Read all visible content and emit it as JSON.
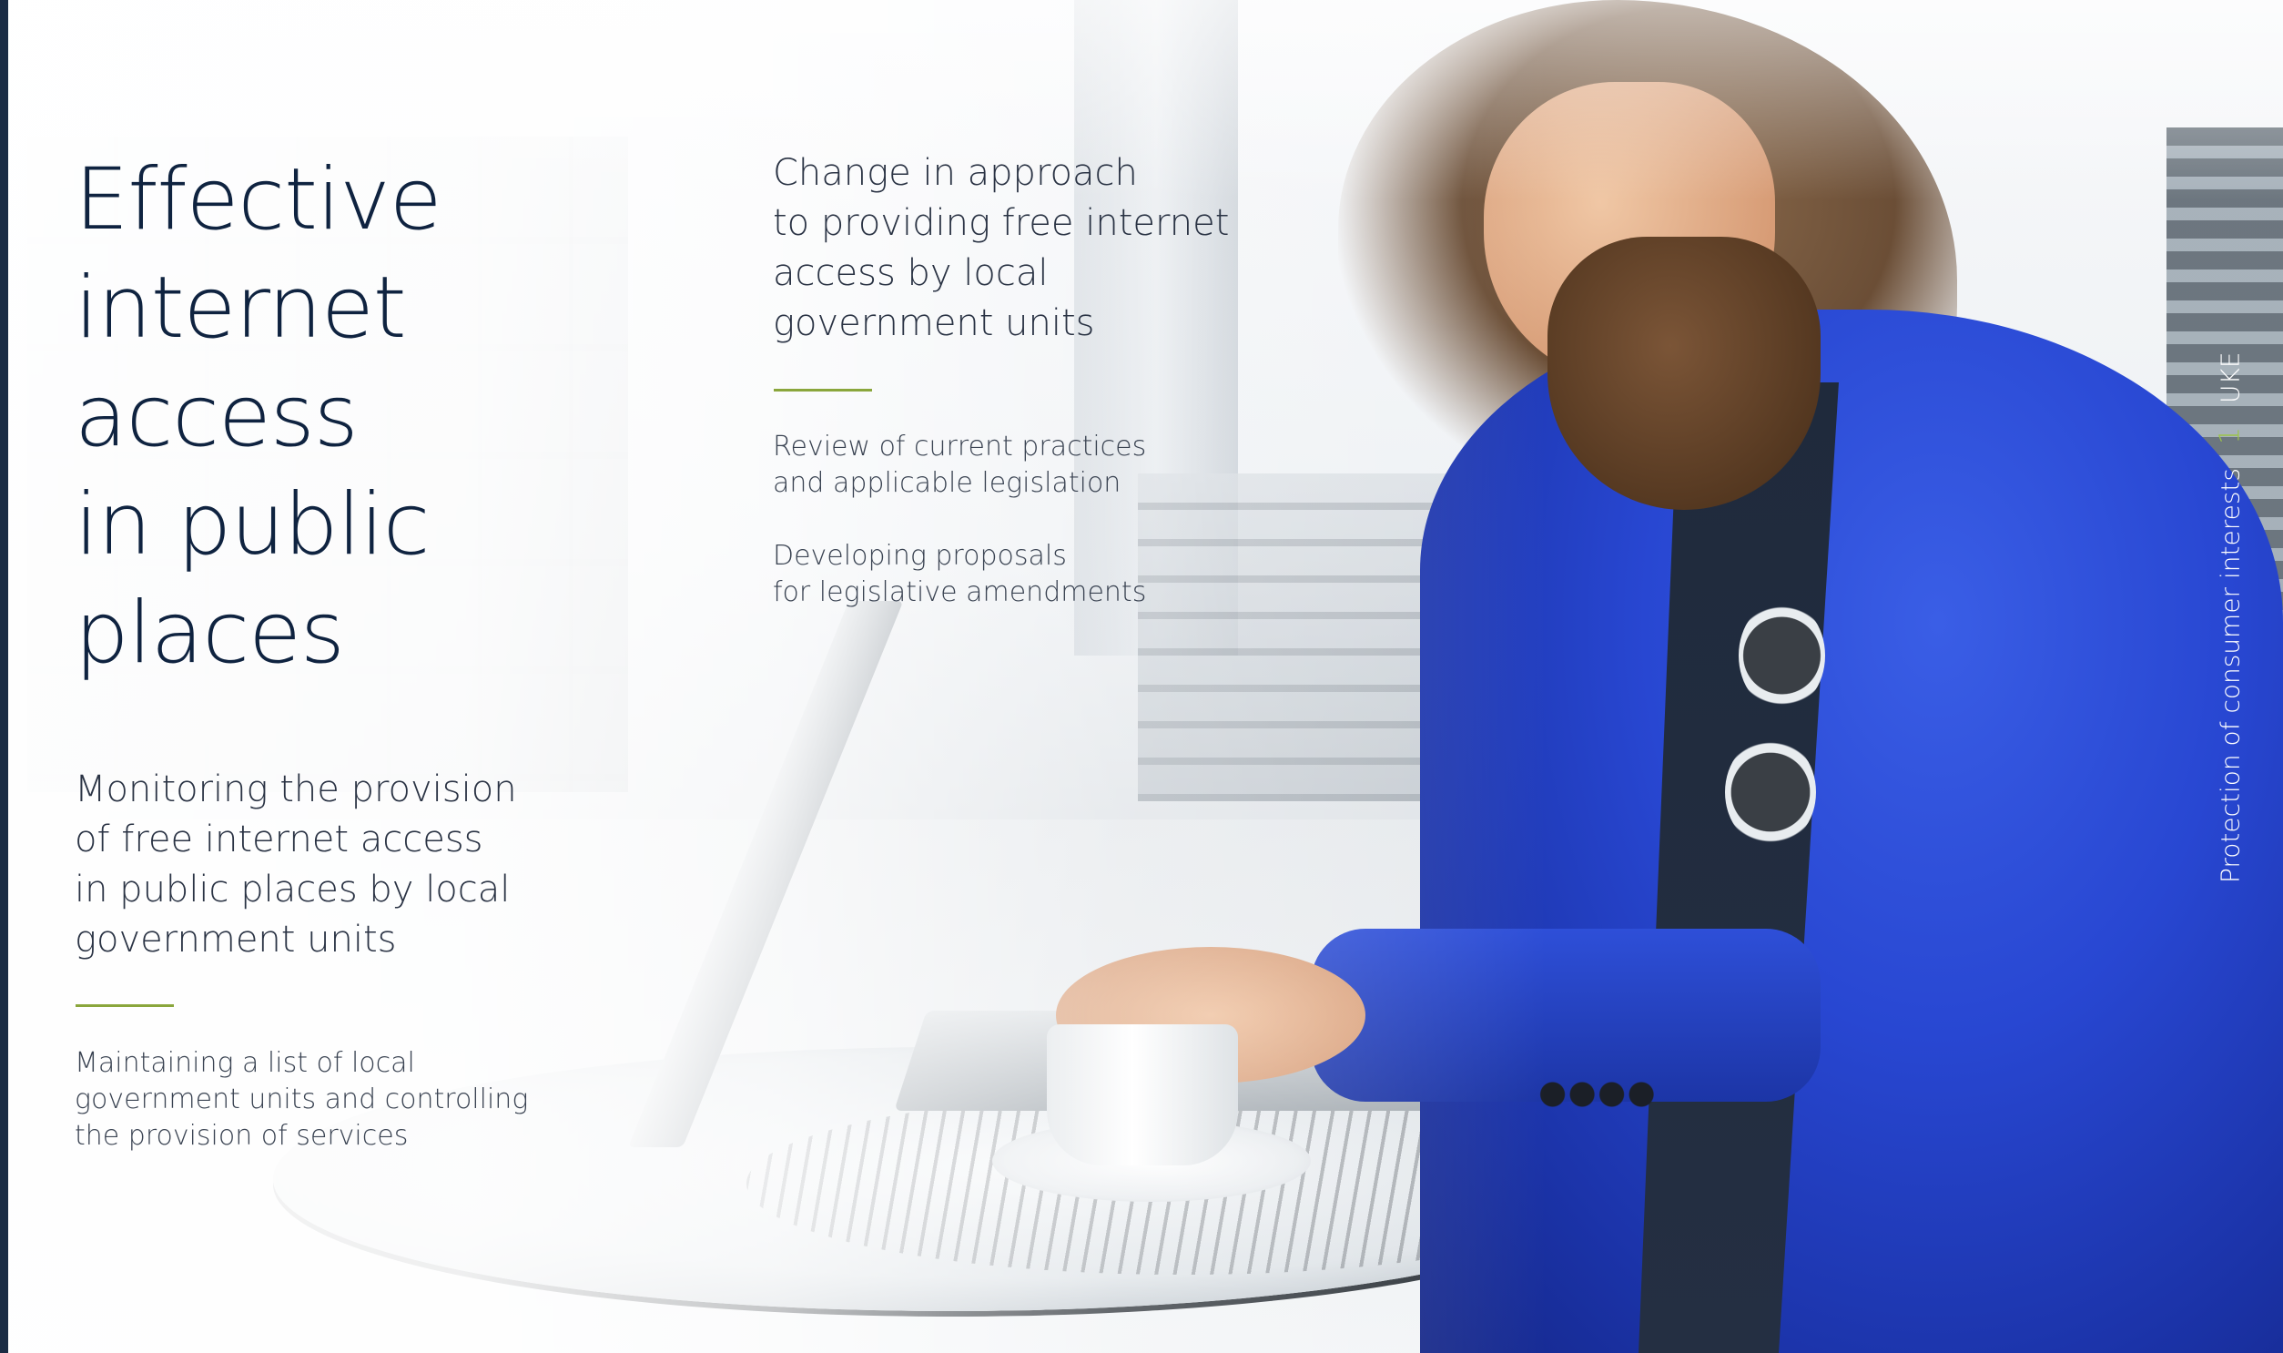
{
  "title_lines": [
    "Effective",
    "internet",
    "access",
    "in public",
    "places"
  ],
  "left_column": {
    "heading_lines": [
      "Monitoring the provision",
      "of free internet access",
      "in public places by local",
      "government units"
    ],
    "body_lines": [
      "Maintaining a list of local",
      "government units and controlling",
      "the provision of services"
    ]
  },
  "right_column": {
    "heading_lines": [
      "Change in approach",
      "to providing free internet",
      "access by local",
      "government units"
    ],
    "item1_lines": [
      "Review of current practices",
      "and applicable legislation"
    ],
    "item2_lines": [
      "Developing proposals",
      "for legislative amendments"
    ]
  },
  "side_strip": {
    "section": "Protection of consumer interests",
    "page_number": "1",
    "brand": "UKE"
  },
  "colors": {
    "title": "#0f2340",
    "accent_rule": "#8aa63c",
    "side_number": "#9cc34a",
    "edge_stripe": "#1a2c44"
  }
}
